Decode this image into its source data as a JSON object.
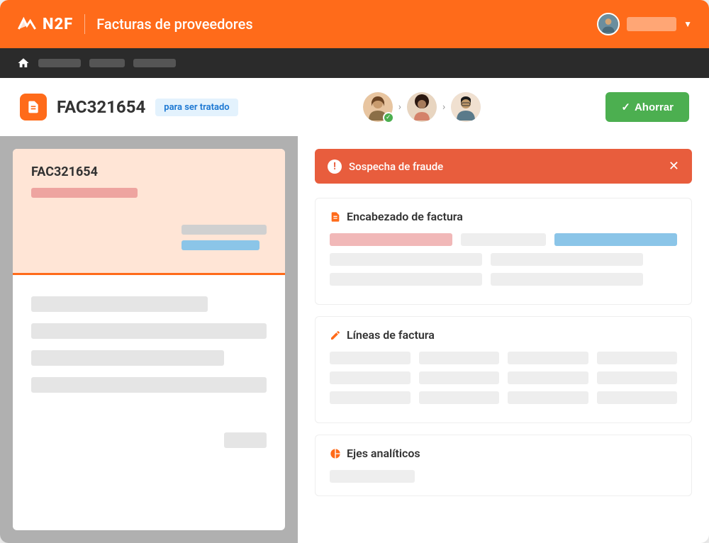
{
  "header": {
    "logo_text": "N2F",
    "app_title": "Facturas de proveedores"
  },
  "document": {
    "title": "FAC321654",
    "status": "para ser tratado",
    "save_label": "Ahorrar"
  },
  "preview": {
    "title": "FAC321654"
  },
  "alert": {
    "text": "Sospecha de fraude"
  },
  "sections": {
    "header": "Encabezado de factura",
    "lines": "Líneas de factura",
    "analytics": "Ejes analíticos"
  }
}
